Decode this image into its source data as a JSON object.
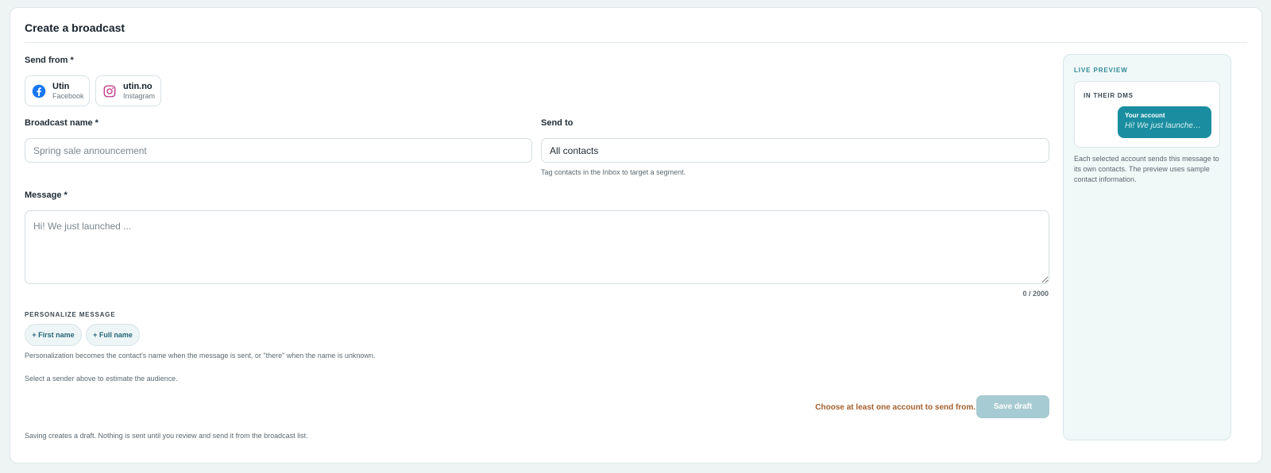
{
  "page": {
    "title": "Create a broadcast"
  },
  "send_from": {
    "label": "Send from *",
    "accounts": [
      {
        "name": "Utin",
        "platform": "Facebook",
        "icon": "facebook-icon"
      },
      {
        "name": "utin.no",
        "platform": "Instagram",
        "icon": "instagram-icon"
      }
    ]
  },
  "broadcast_name": {
    "label": "Broadcast name *",
    "value": "",
    "placeholder": "Spring sale announcement"
  },
  "send_to": {
    "label": "Send to",
    "value": "All contacts",
    "hint": "Tag contacts in the Inbox to target a segment."
  },
  "message": {
    "label": "Message *",
    "value": "",
    "placeholder": "Hi! We just launched ...",
    "counter": "0 / 2000"
  },
  "personalize": {
    "caption": "PERSONALIZE MESSAGE",
    "chips": [
      "+ First name",
      "+ Full name"
    ],
    "hint": "Personalization becomes the contact's name when the message is sent, or \"there\" when the name is unknown."
  },
  "audience_note": "Select a sender above to estimate the audience.",
  "footer": {
    "warning": "Choose at least one account to send from.",
    "save_label": "Save draft",
    "note": "Saving creates a draft. Nothing is sent until you review and send it from the broadcast list."
  },
  "preview": {
    "caption": "LIVE PREVIEW",
    "dm_caption": "IN THEIR DMS",
    "bubble_from": "Your account",
    "bubble_message": "Hi! We just launched ...",
    "note": "Each selected account sends this message to its own contacts. The preview uses sample contact information."
  },
  "colors": {
    "accent": "#1a8ea0",
    "warning": "#a4602e",
    "button_disabled": "#a7cbd2"
  }
}
